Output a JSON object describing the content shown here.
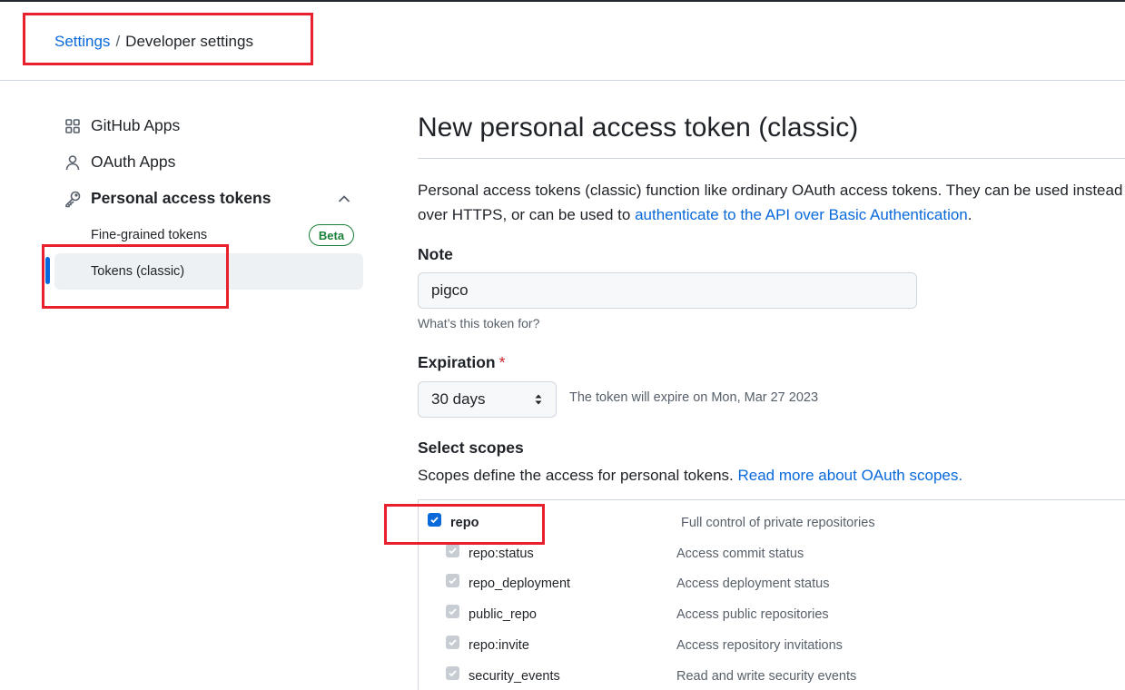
{
  "breadcrumb": {
    "root": "Settings",
    "separator": "/",
    "current": "Developer settings"
  },
  "sidebar": {
    "items": [
      {
        "label": "GitHub Apps",
        "icon": "apps-grid-icon"
      },
      {
        "label": "OAuth Apps",
        "icon": "person-icon"
      },
      {
        "label": "Personal access tokens",
        "icon": "key-icon"
      }
    ],
    "subitems": [
      {
        "label": "Fine-grained tokens",
        "badge": "Beta"
      },
      {
        "label": "Tokens (classic)",
        "active": true
      }
    ]
  },
  "main": {
    "title": "New personal access token (classic)",
    "description_line1": "Personal access tokens (classic) function like ordinary OAuth access tokens. They can be used instead",
    "description_line2_pre": "over HTTPS, or can be used to ",
    "description_link": "authenticate to the API over Basic Authentication",
    "description_line2_post": ".",
    "note": {
      "label": "Note",
      "value": "pigco",
      "hint": "What’s this token for?"
    },
    "expiration": {
      "label": "Expiration",
      "required_mark": "*",
      "selected": "30 days",
      "note": "The token will expire on Mon, Mar 27 2023"
    },
    "scopes": {
      "label": "Select scopes",
      "description": "Scopes define the access for personal tokens. ",
      "link": "Read more about OAuth scopes.",
      "rows": [
        {
          "name": "repo",
          "desc": "Full control of private repositories",
          "checked": true,
          "disabled": false
        },
        {
          "name": "repo:status",
          "desc": "Access commit status",
          "checked": true,
          "disabled": true
        },
        {
          "name": "repo_deployment",
          "desc": "Access deployment status",
          "checked": true,
          "disabled": true
        },
        {
          "name": "public_repo",
          "desc": "Access public repositories",
          "checked": true,
          "disabled": true
        },
        {
          "name": "repo:invite",
          "desc": "Access repository invitations",
          "checked": true,
          "disabled": true
        },
        {
          "name": "security_events",
          "desc": "Read and write security events",
          "checked": true,
          "disabled": true
        }
      ]
    }
  },
  "colors": {
    "link": "#0969da",
    "annotation": "#e8202e",
    "beta": "#1a7f37",
    "required": "#cf222e"
  }
}
